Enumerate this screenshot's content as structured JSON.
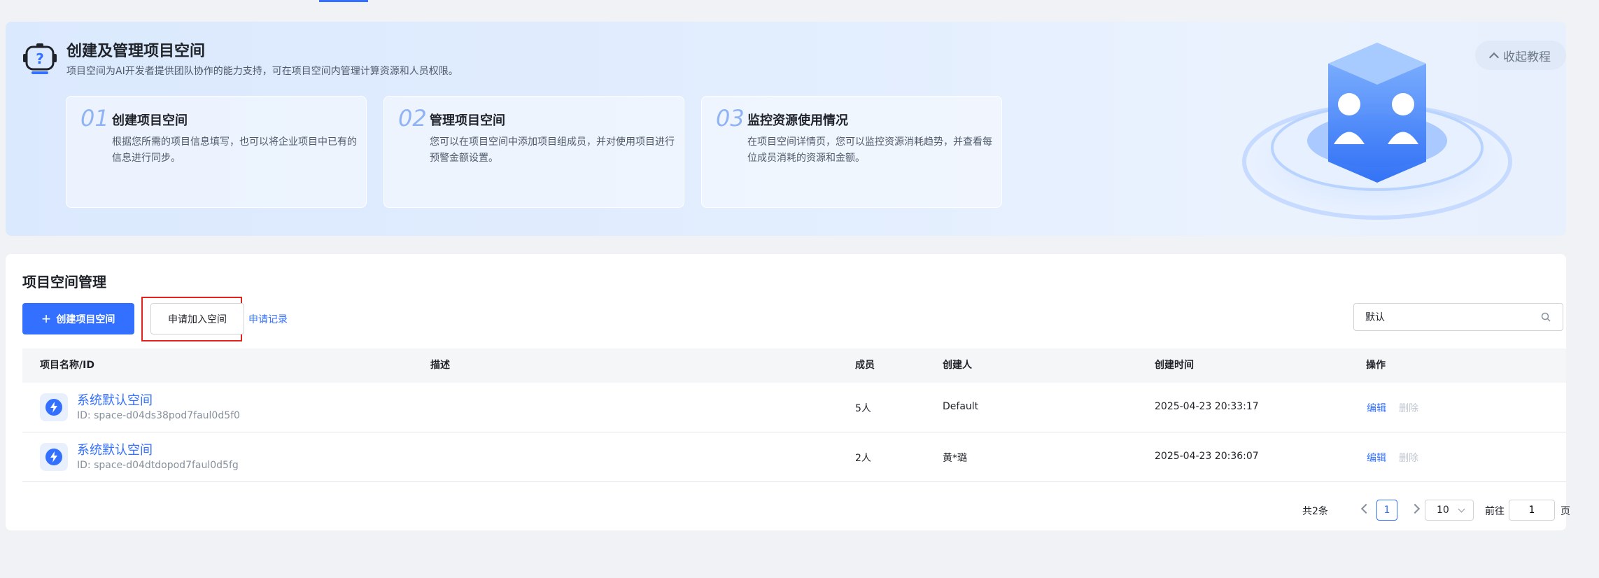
{
  "banner": {
    "title": "创建及管理项目空间",
    "subtitle": "项目空间为AI开发者提供团队协作的能力支持，可在项目空间内管理计算资源和人员权限。",
    "collapse_label": "收起教程",
    "steps": [
      {
        "num": "01",
        "title": "创建项目空间",
        "desc": "根据您所需的项目信息填写，也可以将企业项目中已有的信息进行同步。"
      },
      {
        "num": "02",
        "title": "管理项目空间",
        "desc": "您可以在项目空间中添加项目组成员，并对使用项目进行预警金额设置。"
      },
      {
        "num": "03",
        "title": "监控资源使用情况",
        "desc": "在项目空间详情页，您可以监控资源消耗趋势，并查看每位成员消耗的资源和金额。"
      }
    ]
  },
  "panel": {
    "title": "项目空间管理",
    "create_label": "创建项目空间",
    "join_label": "申请加入空间",
    "records_label": "申请记录",
    "search_value": "默认"
  },
  "table": {
    "headers": [
      "项目名称/ID",
      "描述",
      "成员",
      "创建人",
      "创建时间",
      "操作"
    ],
    "rows": [
      {
        "name": "系统默认空间",
        "id": "ID: space-d04ds38pod7faul0d5f0",
        "desc": "",
        "members": "5人",
        "creator": "Default",
        "created": "2025-04-23 20:33:17",
        "edit": "编辑",
        "delete": "删除"
      },
      {
        "name": "系统默认空间",
        "id": "ID: space-d04dtdopod7faul0d5fg",
        "desc": "",
        "members": "2人",
        "creator": "黄*璐",
        "created": "2025-04-23 20:36:07",
        "edit": "编辑",
        "delete": "删除"
      }
    ]
  },
  "pager": {
    "total": "共2条",
    "current_page": "1",
    "page_size": "10",
    "goto_label": "前往",
    "goto_value": "1",
    "page_label": "页"
  },
  "colors": {
    "accent": "#3370ff",
    "highlight_border": "#e0231c"
  }
}
